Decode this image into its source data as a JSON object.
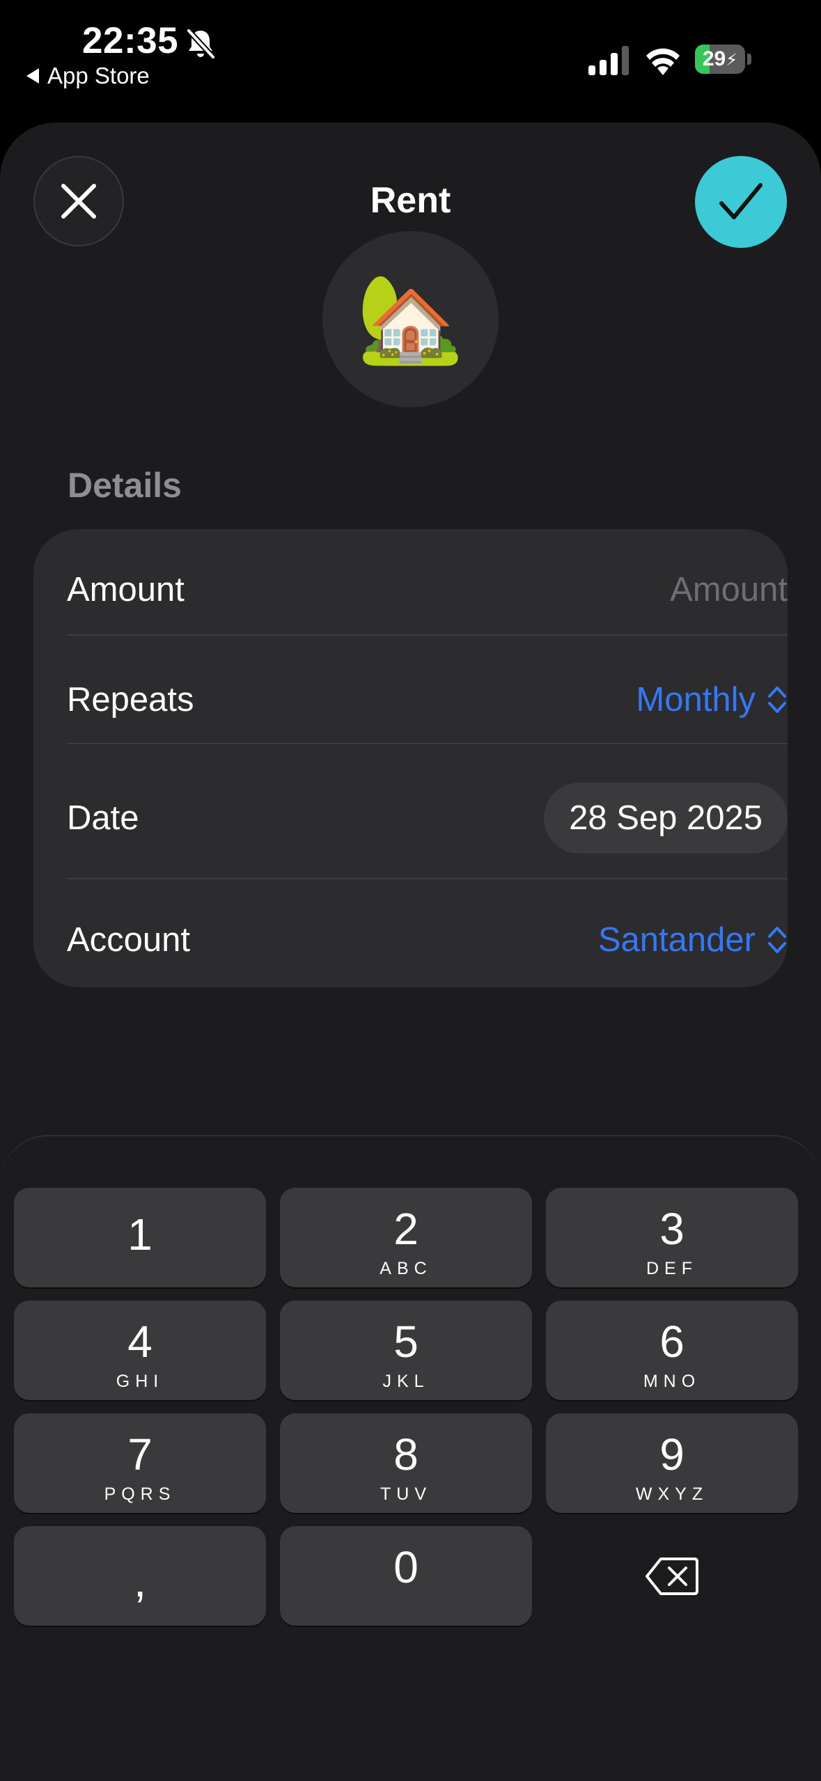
{
  "status_bar": {
    "time": "22:35",
    "back_label": "App Store",
    "battery_level": "29",
    "battery_fraction": 0.29,
    "icons": [
      "bell-slash-icon",
      "cellular-signal-icon",
      "wifi-icon",
      "battery-charging-icon"
    ]
  },
  "header": {
    "title": "Rent",
    "emoji": "🏡",
    "close_icon": "xmark-icon",
    "confirm_icon": "checkmark-icon",
    "confirm_color": "#3ccbd6"
  },
  "details": {
    "section_label": "Details",
    "amount": {
      "label": "Amount",
      "placeholder": "Amount"
    },
    "repeats": {
      "label": "Repeats",
      "value": "Monthly"
    },
    "date": {
      "label": "Date",
      "value": "28 Sep 2025"
    },
    "account": {
      "label": "Account",
      "value": "Santander"
    },
    "link_color": "#3478f6"
  },
  "keypad": {
    "keys": [
      {
        "num": "1",
        "letters": ""
      },
      {
        "num": "2",
        "letters": "ABC"
      },
      {
        "num": "3",
        "letters": "DEF"
      },
      {
        "num": "4",
        "letters": "GHI"
      },
      {
        "num": "5",
        "letters": "JKL"
      },
      {
        "num": "6",
        "letters": "MNO"
      },
      {
        "num": "7",
        "letters": "PQRS"
      },
      {
        "num": "8",
        "letters": "TUV"
      },
      {
        "num": "9",
        "letters": "WXYZ"
      }
    ],
    "comma": ",",
    "zero": "0",
    "delete_icon": "delete-backward-icon"
  }
}
